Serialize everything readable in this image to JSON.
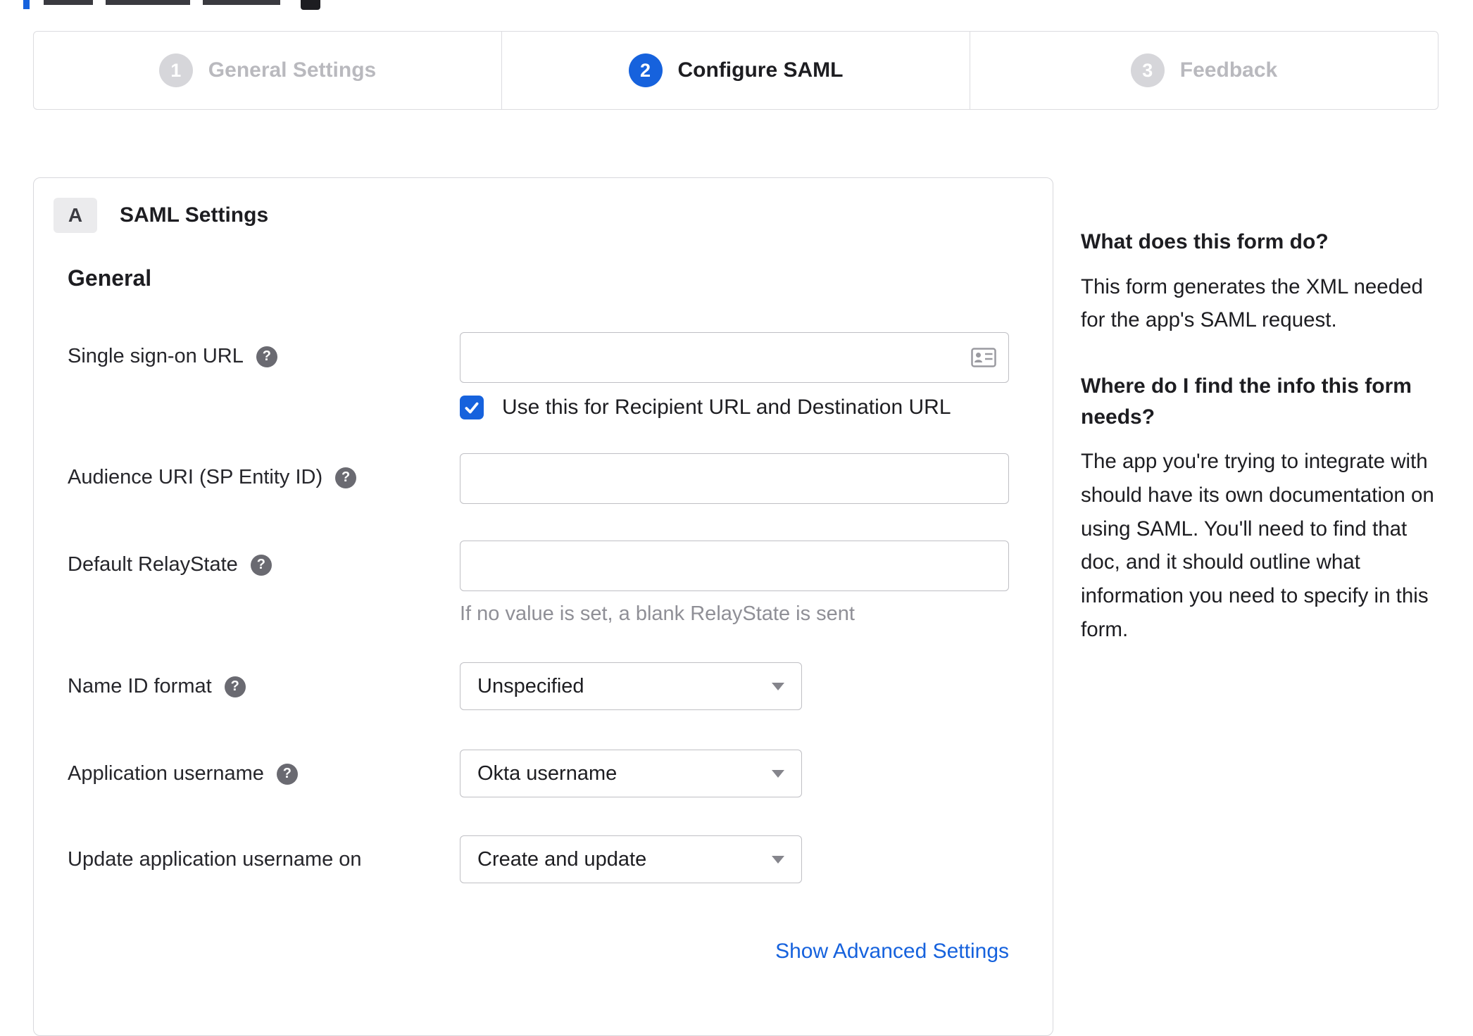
{
  "colors": {
    "accent_blue": "#1662dd",
    "inactive_gray": "#d6d6da",
    "link_blue": "#1662dd"
  },
  "stepper": {
    "steps": [
      {
        "number": "1",
        "label": "General Settings"
      },
      {
        "number": "2",
        "label": "Configure SAML"
      },
      {
        "number": "3",
        "label": "Feedback"
      }
    ]
  },
  "form": {
    "section_badge": "A",
    "section_title": "SAML Settings",
    "group_heading": "General",
    "sso": {
      "label": "Single sign-on URL",
      "value": "",
      "checkbox_label": "Use this for Recipient URL and Destination URL",
      "checkbox_checked": true
    },
    "audience": {
      "label": "Audience URI (SP Entity ID)",
      "value": ""
    },
    "relay": {
      "label": "Default RelayState",
      "value": "",
      "hint": "If no value is set, a blank RelayState is sent"
    },
    "name_id": {
      "label": "Name ID format",
      "value": "Unspecified"
    },
    "app_username": {
      "label": "Application username",
      "value": "Okta username"
    },
    "update_username": {
      "label": "Update application username on",
      "value": "Create and update"
    },
    "advanced_link": "Show Advanced Settings"
  },
  "help_panel": {
    "sections": [
      {
        "heading": "What does this form do?",
        "body": "This form generates the XML needed for the app's SAML request."
      },
      {
        "heading": "Where do I find the info this form needs?",
        "body": "The app you're trying to integrate with should have its own documentation on using SAML. You'll need to find that doc, and it should outline what information you need to specify in this form."
      }
    ]
  },
  "icons": {
    "help": "?"
  }
}
